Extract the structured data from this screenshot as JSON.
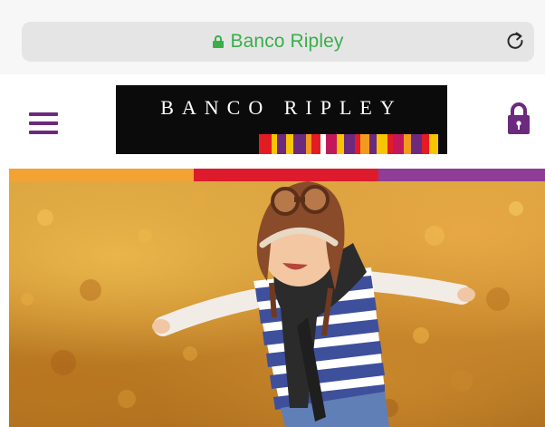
{
  "browser": {
    "url_display": "Banco Ripley",
    "icons": {
      "secure": "lock-icon",
      "reload": "reload-icon"
    }
  },
  "header": {
    "menu_icon": "hamburger-menu-icon",
    "logo_text": "BANCO RIPLEY",
    "login_icon": "lock-icon",
    "colors": {
      "brand_purple": "#6b2a7d",
      "logo_bg": "#0b0b0b"
    }
  },
  "color_strip": {
    "colors": [
      "#f3a234",
      "#dd1b2d",
      "#8f3d96"
    ]
  },
  "hero": {
    "image": "child-pilot-hat-autumn-leaves-image"
  }
}
